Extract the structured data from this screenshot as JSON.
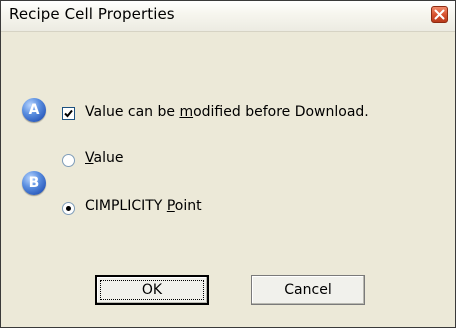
{
  "window": {
    "title": "Recipe Cell Properties"
  },
  "badges": {
    "a": "A",
    "b": "B"
  },
  "checkbox": {
    "label_before": "Value can be ",
    "label_accel": "m",
    "label_after": "odified before Download.",
    "checked": true
  },
  "radios": [
    {
      "label_accel": "V",
      "label_after": "alue",
      "label_before": "",
      "selected": false
    },
    {
      "label_before": "CIMPLICITY ",
      "label_accel": "P",
      "label_after": "oint",
      "selected": true
    }
  ],
  "buttons": {
    "ok": "OK",
    "cancel": "Cancel"
  }
}
